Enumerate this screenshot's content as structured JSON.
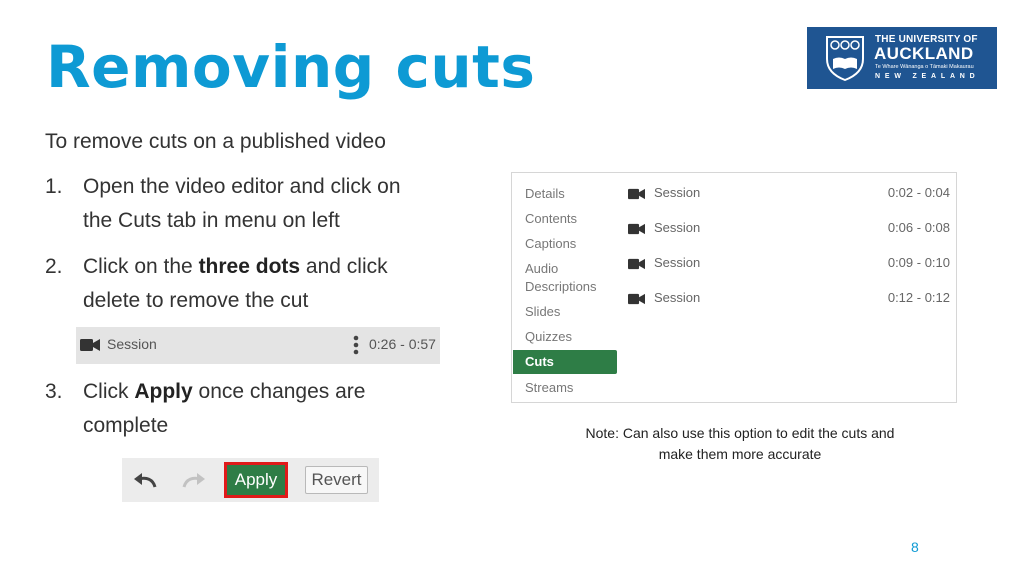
{
  "title": "Removing cuts",
  "logo": {
    "line1": "THE UNIVERSITY OF",
    "line2": "AUCKLAND",
    "line3": "Te Whare Wānanga o Tāmaki Makaurau",
    "line4": "NEW ZEALAND"
  },
  "intro": "To remove cuts on a published video",
  "steps": [
    {
      "num": "1.",
      "line1": "Open the video editor and click on",
      "line2": "the Cuts tab in menu on left"
    },
    {
      "num": "2.",
      "pre": "Click on the ",
      "bold": "three dots",
      "post": " and click",
      "line2": "delete to remove the cut"
    },
    {
      "num": "3.",
      "pre": "Click ",
      "bold": "Apply",
      "post": " once changes are",
      "line2": "complete"
    }
  ],
  "session_bar": {
    "label": "Session",
    "time": "0:26 - 0:57"
  },
  "toolbar": {
    "apply": "Apply",
    "revert": "Revert"
  },
  "editor": {
    "menu": [
      {
        "label": "Details"
      },
      {
        "label": "Contents"
      },
      {
        "label": "Captions"
      },
      {
        "label": "Audio"
      },
      {
        "label": "Descriptions"
      },
      {
        "label": "Slides"
      },
      {
        "label": "Quizzes"
      },
      {
        "label": "Cuts",
        "active": true
      },
      {
        "label": "Streams"
      }
    ],
    "sessions": [
      {
        "label": "Session",
        "time": "0:02 - 0:04"
      },
      {
        "label": "Session",
        "time": "0:06 - 0:08"
      },
      {
        "label": "Session",
        "time": "0:09 - 0:10"
      },
      {
        "label": "Session",
        "time": "0:12 - 0:12"
      }
    ]
  },
  "note": {
    "line1": "Note: Can also use this option to edit the cuts and",
    "line2": "make them more accurate"
  },
  "page_number": "8",
  "colors": {
    "title": "#0e9ad4",
    "logo_bg": "#1f5592",
    "active_green": "#2e7d46",
    "highlight_red": "#e01a1a"
  }
}
